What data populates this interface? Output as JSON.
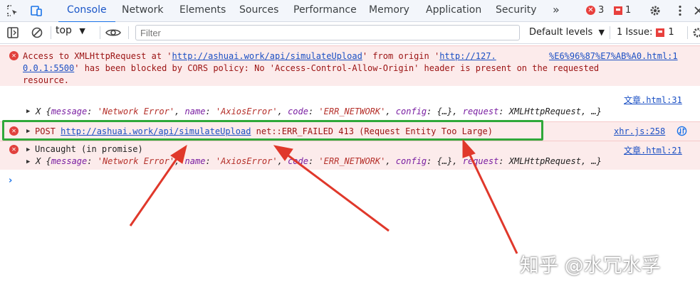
{
  "tabs": [
    {
      "label": "Console",
      "active": true
    },
    {
      "label": "Network"
    },
    {
      "label": "Elements"
    },
    {
      "label": "Sources"
    },
    {
      "label": "Performance"
    },
    {
      "label": "Memory"
    },
    {
      "label": "Application"
    },
    {
      "label": "Security"
    }
  ],
  "tabbar": {
    "more_label": "»",
    "error_count": "3",
    "issue_count": "1"
  },
  "toolbar": {
    "context": "top",
    "filter_placeholder": "Filter",
    "levels": "Default levels",
    "issues_label": "1 Issue:",
    "issues_count": "1"
  },
  "messages": {
    "cors": {
      "line1_prefix": "Access to XMLHttpRequest at '",
      "line1_url": "http://ashuai.work/api/simulateUpload",
      "line1_mid": "' from origin '",
      "line1_origin_a": "http://127.",
      "line1_origin_b": "%E6%96%87%E7%AB%A0.html:1",
      "line2_origin": "0.0.1:5500",
      "line2_rest": "' has been blocked by CORS policy: No 'Access-Control-Allow-Origin' header is present on the requested",
      "line3": "resource."
    },
    "log1": {
      "source": "文章.html:31",
      "obj_prefix": "X {",
      "k1": "message",
      "v1": "'Network Error'",
      "k2": "name",
      "v2": "'AxiosError'",
      "k3": "code",
      "v3": "'ERR_NETWORK'",
      "k4": "config",
      "v4": "{…}",
      "k5": "request",
      "v5": "XMLHttpRequest",
      "tail": ", …}"
    },
    "post": {
      "method": "POST ",
      "url": "http://ashuai.work/api/simulateUpload",
      "rest": " net::ERR_FAILED 413 (Request Entity Too Large)",
      "source": "xhr.js:258"
    },
    "uncaught": {
      "label": "Uncaught (in promise)",
      "source": "文章.html:21"
    }
  },
  "watermark": "知乎 @水冗水孚",
  "colors": {
    "accent": "#1a73e8",
    "error": "#e1413d",
    "error_bg": "#fcebeb",
    "highlight": "#2fa83a",
    "arrow": "#e0382b"
  }
}
